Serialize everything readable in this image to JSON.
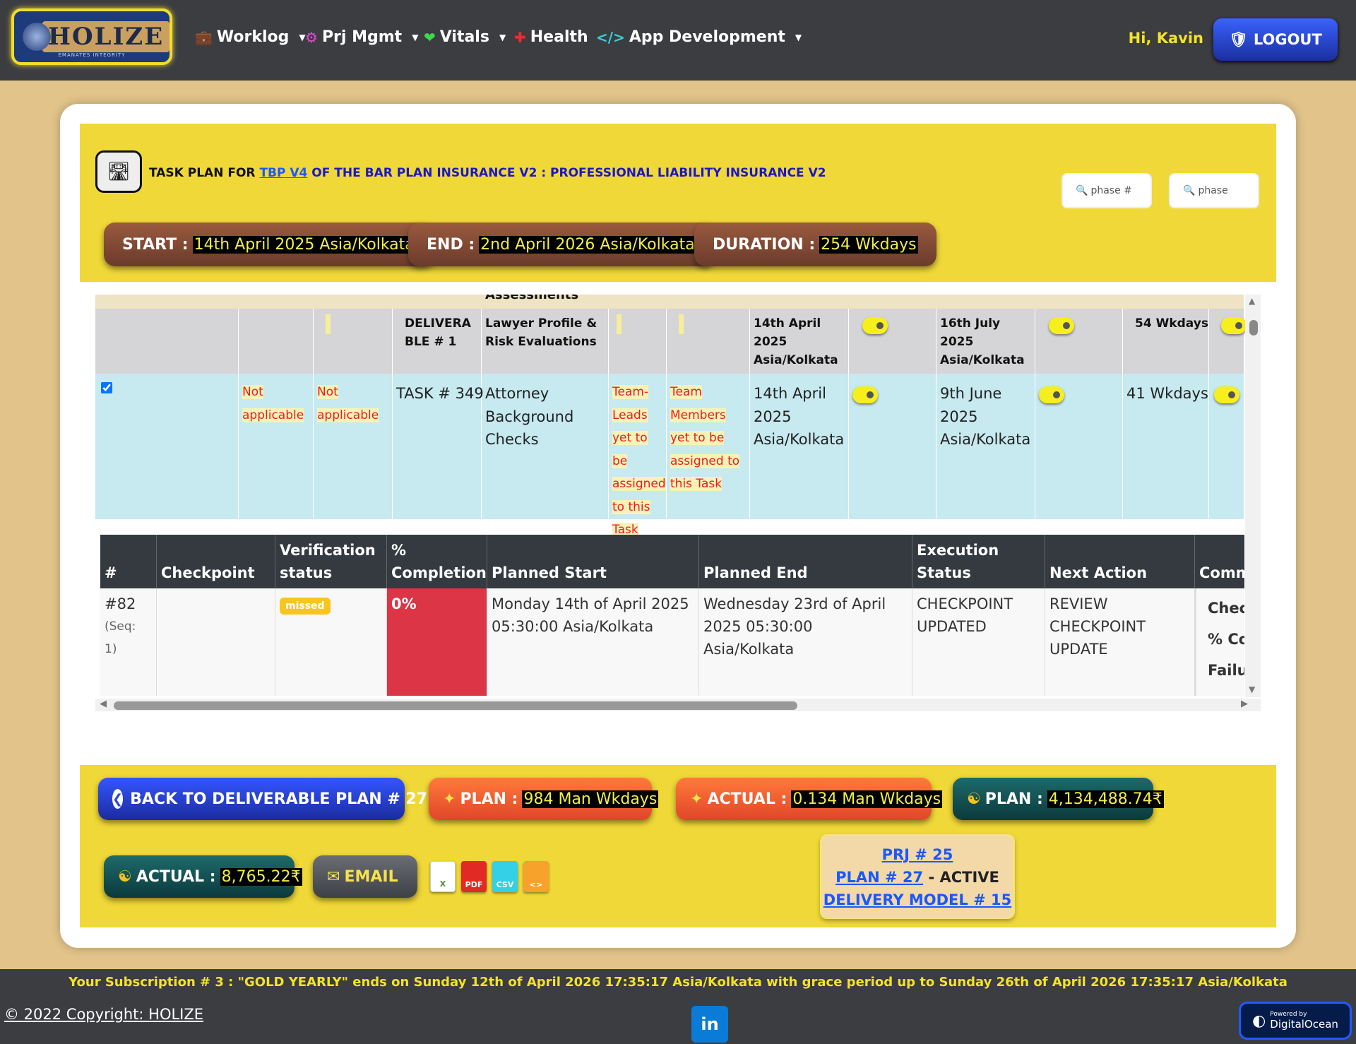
{
  "nav": {
    "logo_text": "HOLIZE",
    "logo_tagline": "EMANATES INTEGRITY",
    "items": [
      {
        "label": "Worklog",
        "icon": "briefcase-icon",
        "dropdown": true
      },
      {
        "label": "Prj Mgmt",
        "icon": "sitemap-icon",
        "dropdown": true
      },
      {
        "label": "Vitals",
        "icon": "heartbeat-icon",
        "dropdown": true
      },
      {
        "label": "Health",
        "icon": "first-aid-icon",
        "dropdown": false
      },
      {
        "label": "App Development",
        "icon": "code-icon",
        "dropdown": true
      }
    ],
    "greeting": "Hi, Kavin",
    "logout_label": "LOGOUT"
  },
  "header": {
    "title_prefix": "TASK PLAN FOR",
    "title_link": "TBP V4",
    "title_suffix": "OF THE BAR PLAN INSURANCE V2 : PROFESSIONAL LIABILITY INSURANCE V2",
    "search_phase_num_placeholder": "phase #",
    "search_phase_placeholder": "phase",
    "start_label": "START :",
    "start_value": "14th April 2025 Asia/Kolkata",
    "end_label": "END :",
    "end_value": "2nd April 2026 Asia/Kolkata",
    "duration_label": "DURATION :",
    "duration_value": "254 Wkdays"
  },
  "task_grid": {
    "strip_text": "Assessments",
    "deliverable_row": {
      "deliverable": "DELIVERABLE # 1",
      "name": "Lawyer Profile & Risk Evaluations",
      "start": "14th April 2025 Asia/Kolkata",
      "end": "16th July 2025 Asia/Kolkata",
      "duration": "54 Wkdays"
    },
    "task_row": {
      "checked": true,
      "col1": "Not applicable",
      "col2": "Not applicable",
      "task": "TASK # 349",
      "name": "Attorney Background Checks",
      "leads": "Team-Leads yet to be assigned to this Task",
      "members": "Team Members yet to be assigned to this Task",
      "start": "14th April 2025 Asia/Kolkata",
      "end": "9th June 2025 Asia/Kolkata",
      "duration": "41 Wkdays"
    }
  },
  "checkpoint_table": {
    "headers": [
      "#",
      "Checkpoint",
      "Verification status",
      "% Completion",
      "Planned Start",
      "Planned End",
      "Execution Status",
      "Next Action",
      "Comm"
    ],
    "row": {
      "num": "#82",
      "seq": "(Seq: 1)",
      "checkpoint": "",
      "verification": "missed",
      "completion": "0%",
      "planned_start": "Monday 14th of April 2025 05:30:00 Asia/Kolkata",
      "planned_end": "Wednesday 23rd of April 2025 05:30:00 Asia/Kolkata",
      "execution_status": "CHECKPOINT UPDATED",
      "next_action": "REVIEW CHECKPOINT UPDATE",
      "comments": [
        "Check",
        "% Cor",
        "Failur"
      ]
    }
  },
  "footer": {
    "back_label": "BACK TO DELIVERABLE PLAN # 27",
    "plan_effort_label": "PLAN :",
    "plan_effort_value": "984 Man Wkdays",
    "actual_effort_label": "ACTUAL :",
    "actual_effort_value": "0.134 Man Wkdays",
    "plan_cost_label": "PLAN :",
    "plan_cost_value": "4,134,488.74₹",
    "actual_cost_label": "ACTUAL :",
    "actual_cost_value": "8,765.22₹",
    "email_label": "EMAIL",
    "export_icons": [
      "excel-icon",
      "pdf-icon",
      "csv-icon",
      "code-file-icon"
    ],
    "prj_link": "PRJ # 25",
    "plan_link": "PLAN # 27",
    "plan_status": "- ACTIVE",
    "delivery_link": "DELIVERY MODEL # 15"
  },
  "bottom_bar": {
    "subscription": "Your Subscription # 3 : \"GOLD YEARLY\" ends on Sunday 12th of April 2026 17:35:17 Asia/Kolkata with grace period up to Sunday 26th of April 2026 17:35:17 Asia/Kolkata",
    "copyright": "© 2022 Copyright: HOLIZE",
    "linkedin": "in",
    "do_powered": "Powered by",
    "do_name": "DigitalOcean"
  },
  "colors": {
    "navbar": "#3c3d41",
    "accent_yellow": "#f0d838",
    "page_bg": "#e2c48a",
    "completion_red": "#dc3545",
    "missed_badge": "#f8c51c"
  }
}
